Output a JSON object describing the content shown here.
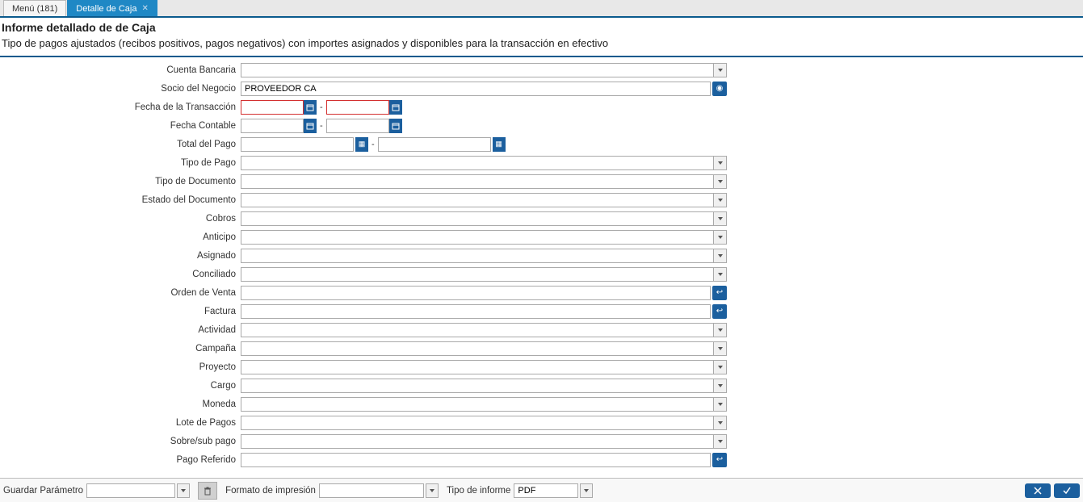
{
  "tabs": [
    {
      "label": "Menú (181)",
      "active": false
    },
    {
      "label": "Detalle de Caja",
      "active": true
    }
  ],
  "page": {
    "title": "Informe detallado de de Caja",
    "subtitle": "Tipo de pagos ajustados (recibos positivos, pagos negativos) con importes asignados y disponibles para la transacción en efectivo"
  },
  "form": {
    "cuenta_bancaria": {
      "label": "Cuenta Bancaria",
      "value": ""
    },
    "socio_negocio": {
      "label": "Socio del Negocio",
      "value": "PROVEEDOR CA"
    },
    "fecha_transaccion": {
      "label": "Fecha de la Transacción",
      "from": "",
      "to": "",
      "required": true
    },
    "fecha_contable": {
      "label": "Fecha Contable",
      "from": "",
      "to": "",
      "required": false
    },
    "total_pago": {
      "label": "Total del Pago",
      "from": "",
      "to": ""
    },
    "tipo_pago": {
      "label": "Tipo de Pago",
      "value": ""
    },
    "tipo_documento": {
      "label": "Tipo de Documento",
      "value": ""
    },
    "estado_documento": {
      "label": "Estado del Documento",
      "value": ""
    },
    "cobros": {
      "label": "Cobros",
      "value": ""
    },
    "anticipo": {
      "label": "Anticipo",
      "value": ""
    },
    "asignado": {
      "label": "Asignado",
      "value": ""
    },
    "conciliado": {
      "label": "Conciliado",
      "value": ""
    },
    "orden_venta": {
      "label": "Orden de Venta",
      "value": ""
    },
    "factura": {
      "label": "Factura",
      "value": ""
    },
    "actividad": {
      "label": "Actividad",
      "value": ""
    },
    "campana": {
      "label": "Campaña",
      "value": ""
    },
    "proyecto": {
      "label": "Proyecto",
      "value": ""
    },
    "cargo": {
      "label": "Cargo",
      "value": ""
    },
    "moneda": {
      "label": "Moneda",
      "value": ""
    },
    "lote_pagos": {
      "label": "Lote de Pagos",
      "value": ""
    },
    "sobre_sub_pago": {
      "label": "Sobre/sub pago",
      "value": ""
    },
    "pago_referido": {
      "label": "Pago Referido",
      "value": ""
    }
  },
  "footer": {
    "guardar_parametro": {
      "label": "Guardar Parámetro",
      "value": ""
    },
    "formato_impresion": {
      "label": "Formato de impresión",
      "value": ""
    },
    "tipo_informe": {
      "label": "Tipo de informe",
      "value": "PDF"
    }
  }
}
